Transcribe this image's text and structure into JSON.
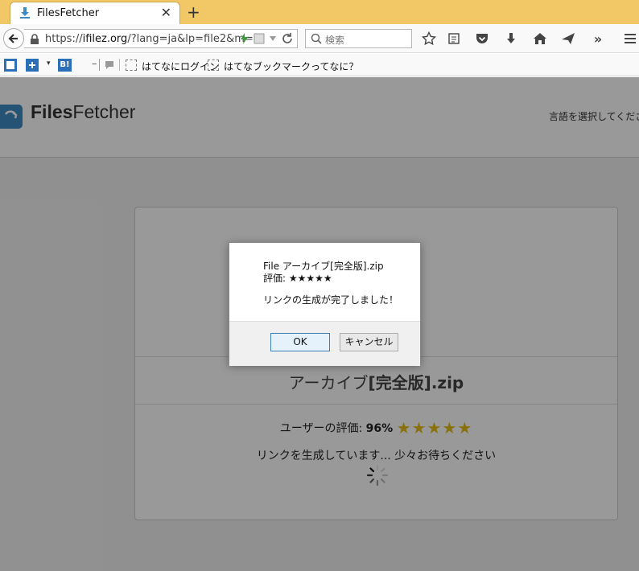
{
  "browser": {
    "tab_title": "FilesFetcher",
    "url_scheme": "https://",
    "url_host": "ifilez.org",
    "url_rest": "/?lang=ja&lp=file2&m=",
    "search_placeholder": "検索"
  },
  "bookmarks": {
    "hatena_login": "はてなにログイン",
    "hatena_about": "はてなブックマークってなに？",
    "hatena_b_label": "B!"
  },
  "site": {
    "logo_bold": "Files",
    "logo_rest": "Fetcher",
    "lang_link": "言語を選択してください"
  },
  "card": {
    "file_prefix": "アーカイブ",
    "file_bold": "[完全版]",
    "file_ext": ".zip",
    "rating_label": "ユーザーの評価: ",
    "rating_pct": "96%",
    "rating_stars": "★★★★★",
    "generating": "リンクを生成しています... 少々お待ちください"
  },
  "dialog": {
    "line1": "File アーカイブ[完全版].zip",
    "line2": "評価: ★★★★★",
    "line3": "リンクの生成が完了しました！",
    "ok_label": "OK",
    "cancel_label": "キャンセル"
  },
  "colors": {
    "tabstrip": "#f2c766",
    "logo_blue": "#3c8bc4",
    "star_gold": "#e6bd1c"
  }
}
